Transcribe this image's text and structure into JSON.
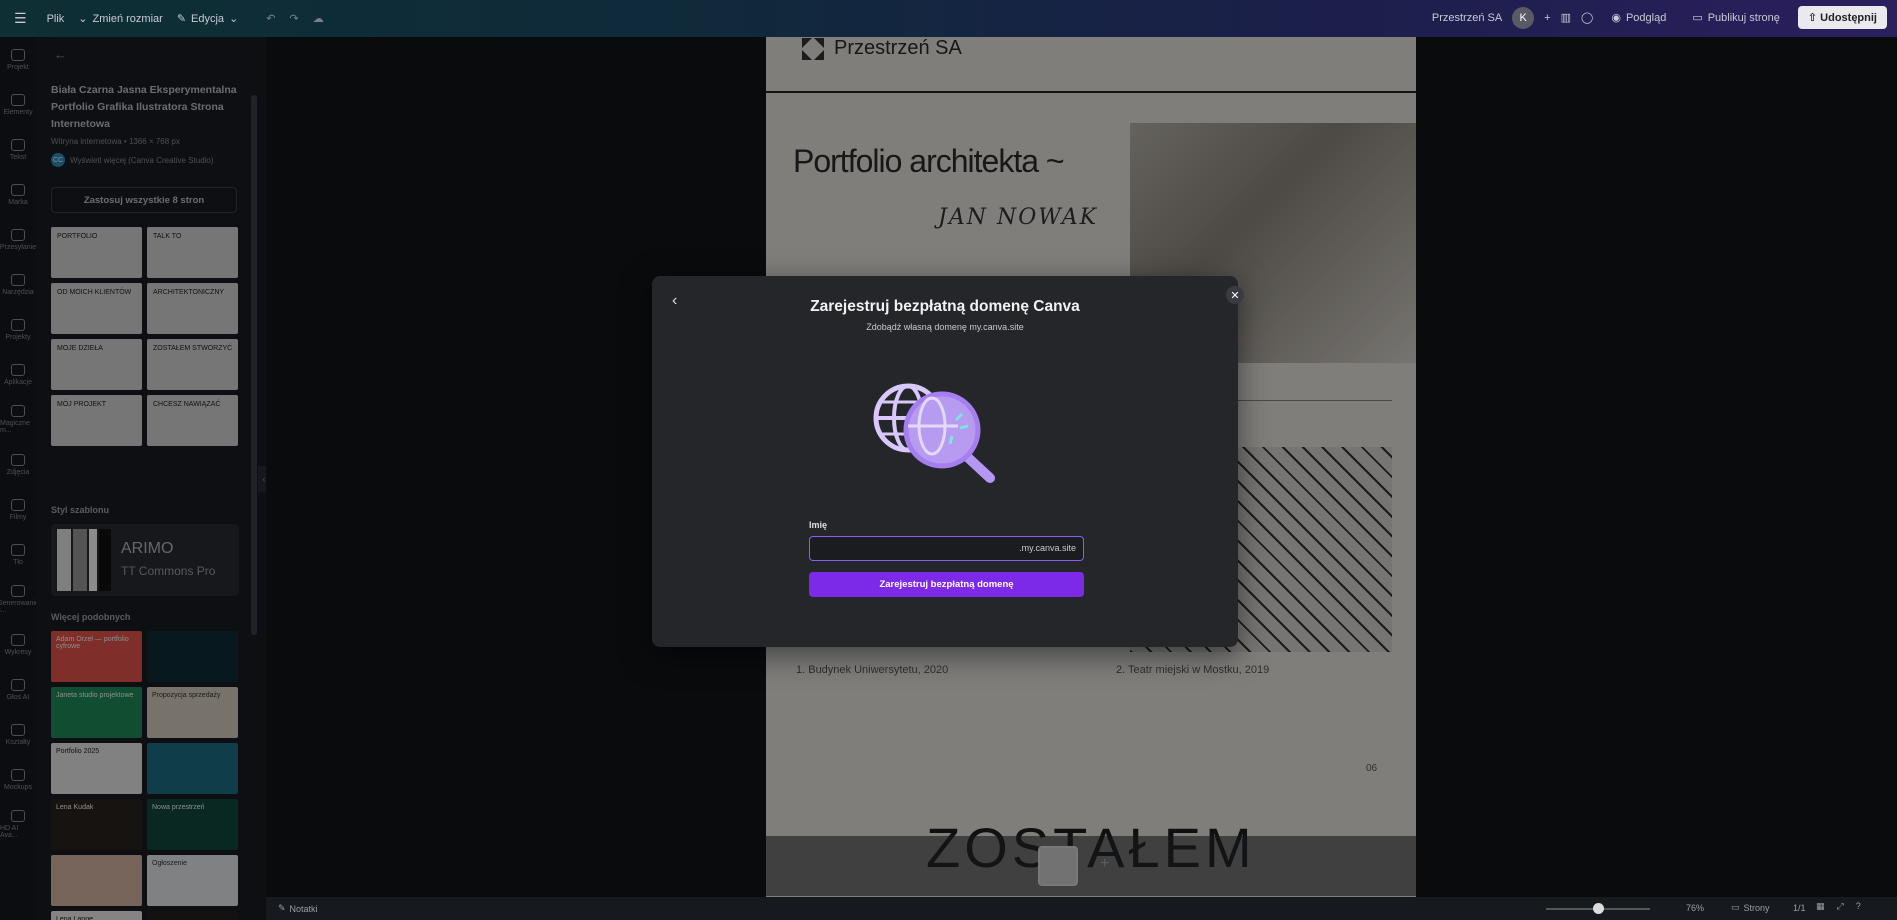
{
  "topbar": {
    "file": "Plik",
    "resize": "Zmień rozmiar",
    "edit": "Edycja",
    "workspace": "Przestrzeń SA",
    "avatar": "K",
    "preview": "Podgląd",
    "publish": "Publikuj stronę",
    "share": "Udostępnij"
  },
  "rail": [
    {
      "label": "Projekt"
    },
    {
      "label": "Elementy"
    },
    {
      "label": "Tekst"
    },
    {
      "label": "Marka"
    },
    {
      "label": "Przesyłanie"
    },
    {
      "label": "Narzędzia"
    },
    {
      "label": "Projekty"
    },
    {
      "label": "Aplikacje"
    },
    {
      "label": "Magiczne m..."
    },
    {
      "label": "Zdjęcia"
    },
    {
      "label": "Filmy"
    },
    {
      "label": "Tło"
    },
    {
      "label": "Generowanie s..."
    },
    {
      "label": "Wykresy"
    },
    {
      "label": "Głos AI"
    },
    {
      "label": "Kształty"
    },
    {
      "label": "Mockups"
    },
    {
      "label": "HD AI Ava..."
    }
  ],
  "panel": {
    "title": "Biała Czarna Jasna Eksperymentalna Portfolio Grafika Ilustratora Strona Internetowa",
    "meta": "Witryna internetowa • 1366 × 768 px",
    "author_initials": "CC",
    "author": "Wyświetl więcej (Canva Creative Studio)",
    "apply_all": "Zastosuj wszystkie 8 stron",
    "thumbs": [
      "PORTFOLIO",
      "TALK TO",
      "OD MOICH KLIENTÓW",
      "ARCHITEKTONICZNY",
      "MOJE DZIEŁA",
      "ZOSTAŁEM STWORZYĆ",
      "MÓJ PROJEKT",
      "CHCESZ NAWIĄZAĆ"
    ],
    "style_label": "Styl szablonu",
    "style_font1": "ARIMO",
    "style_font2": "TT Commons Pro",
    "more_label": "Więcej podobnych",
    "more": [
      {
        "text": "Adam Orzeł — portfolio cyfrowe",
        "bg": "#e8554e",
        "fg": "#ffffff"
      },
      {
        "text": "",
        "bg": "#0e2f3a",
        "fg": "#ffffff"
      },
      {
        "text": "Janeta studio projektowe",
        "bg": "#1f8f5a",
        "fg": "#ffffff"
      },
      {
        "text": "Propozycja sprzedaży",
        "bg": "#d9d2c3",
        "fg": "#333333"
      },
      {
        "text": "Portfolio 2025",
        "bg": "#ececec",
        "fg": "#222222"
      },
      {
        "text": "",
        "bg": "#1c6f86",
        "fg": "#ffffff"
      },
      {
        "text": "Lena Kudak",
        "bg": "#2a2420",
        "fg": "#ffffff"
      },
      {
        "text": "Nowa przestrzeń",
        "bg": "#0f4a3d",
        "fg": "#ffffff"
      },
      {
        "text": "",
        "bg": "#d9b9a6",
        "fg": "#333333"
      },
      {
        "text": "Ogłoszenie",
        "bg": "#e9ecef",
        "fg": "#333333"
      },
      {
        "text": "Lena Lange",
        "bg": "#f0f0f0",
        "fg": "#222222"
      },
      {
        "text": "",
        "bg": "#222222",
        "fg": "#ffffff"
      }
    ]
  },
  "page": {
    "brand": "Przestrzeń SA",
    "title": "Portfolio architekta ~",
    "author": "JAN NOWAK",
    "caption1": "1.     Budynek Uniwersytetu, 2020",
    "caption2": "2.     Teatr miejski w Mostku, 2019",
    "page_number": "06",
    "big_text": "ZOSTAŁEM"
  },
  "modal": {
    "title": "Zarejestruj bezpłatną domenę Canva",
    "subtitle": "Zdobądź własną domenę my.canva.site",
    "name_label": "Imię",
    "input_value": "",
    "suffix": ".my.canva.site",
    "submit": "Zarejestruj bezpłatną domenę",
    "colors": {
      "accent": "#7d2ae8",
      "input_border": "#8b5cf6"
    }
  },
  "bottombar": {
    "notes": "Notatki",
    "zoom": "76%",
    "pages": "Strony",
    "page_count": "1/1"
  }
}
